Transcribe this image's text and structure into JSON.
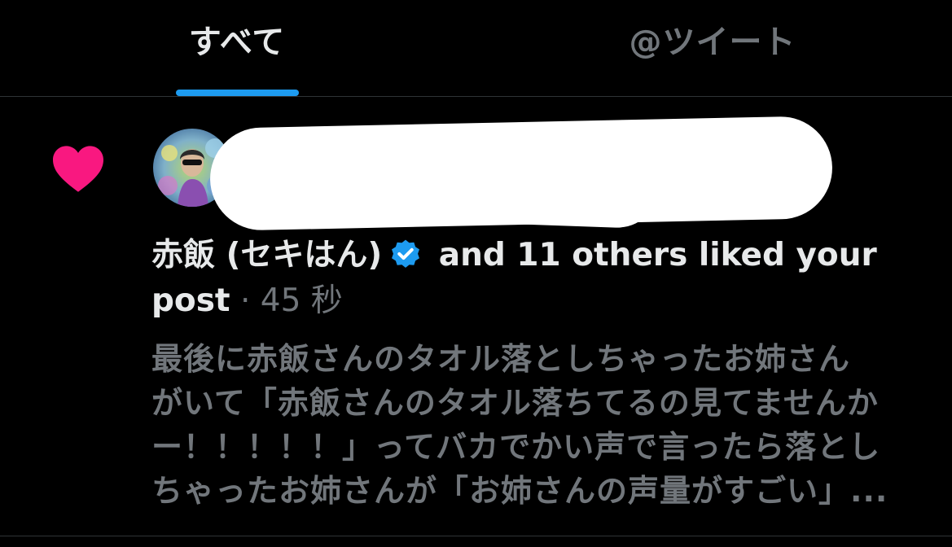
{
  "tabs": {
    "all_label": "すべて",
    "mentions_label": "@ツイート",
    "active": "all"
  },
  "notification": {
    "icon": "heart-icon",
    "actor_name": "赤飯 (セキはん)",
    "verified_icon": "verified-badge-icon",
    "action_text": " and 11 others liked your post",
    "separator": " · ",
    "time": "45 秒",
    "post_text": "最後に赤飯さんのタオル落としちゃったお姉さん\nがいて「赤飯さんのタオル落ちてるの見てませんか\nー！！！！！」ってバカでかい声で言ったら落とし\nちゃったお姉さんが「お姉さんの声量がすごい」..."
  },
  "colors": {
    "background": "#000000",
    "primary_text": "#e7e9ea",
    "secondary_text": "#71767b",
    "accent": "#1d9bf0",
    "like": "#f91880",
    "divider": "#2f3336",
    "redaction": "#ffffff"
  }
}
